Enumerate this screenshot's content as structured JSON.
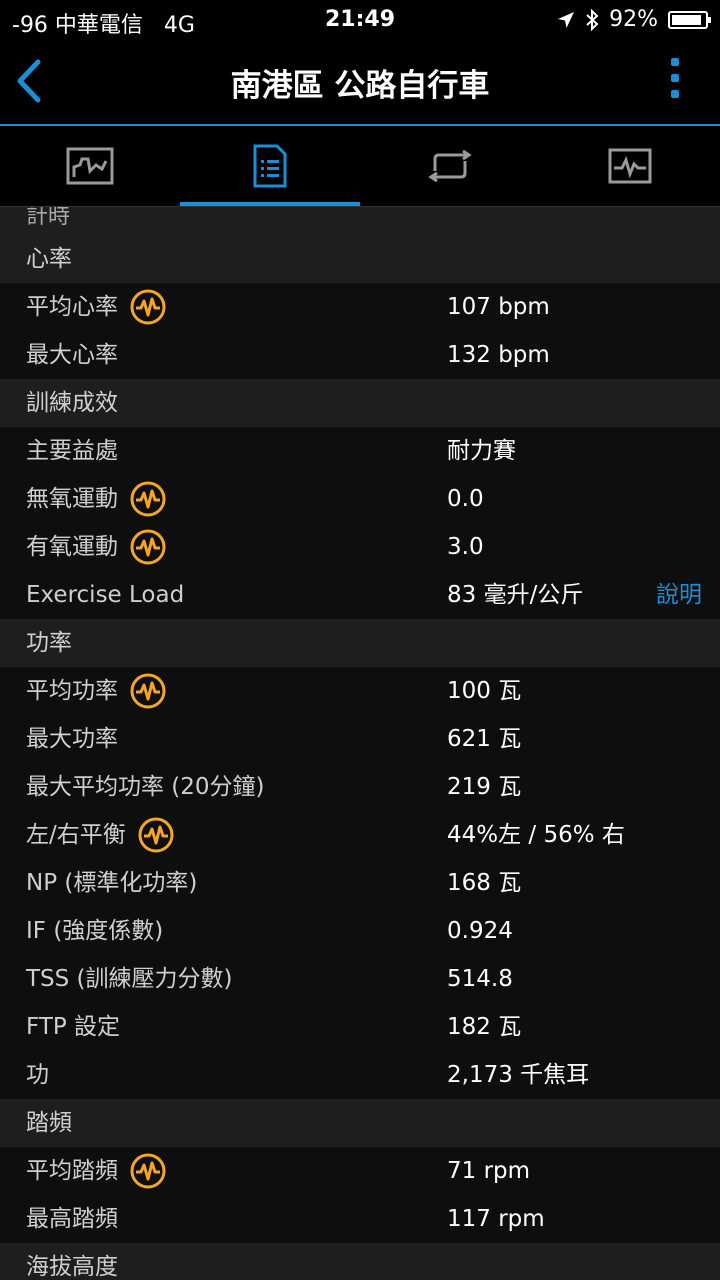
{
  "status": {
    "carrier": "-96 中華電信",
    "network": "4G",
    "time": "21:49",
    "battery": "92%",
    "battery_level": 0.92
  },
  "nav": {
    "title": "南港區 公路自行車"
  },
  "content": {
    "top_partial": "計時",
    "heart_rate": {
      "header": "心率",
      "rows": [
        {
          "label": "平均心率",
          "value": "107 bpm"
        },
        {
          "label": "最大心率",
          "value": "132 bpm"
        }
      ]
    },
    "training": {
      "header": "訓練成效",
      "rows": [
        {
          "label": "主要益處",
          "value": "耐力賽"
        },
        {
          "label": "無氧運動",
          "value": "0.0"
        },
        {
          "label": "有氧運動",
          "value": "3.0"
        },
        {
          "label": "Exercise Load",
          "value": "83 毫升/公斤",
          "link": "說明"
        }
      ]
    },
    "power": {
      "header": "功率",
      "rows": [
        {
          "label": "平均功率",
          "value": "100 瓦"
        },
        {
          "label": "最大功率",
          "value": "621 瓦"
        },
        {
          "label": "最大平均功率 (20分鐘)",
          "value": "219 瓦"
        },
        {
          "label": "左/右平衡",
          "value": "44%左 / 56% 右"
        },
        {
          "label": "NP (標準化功率)",
          "value": "168 瓦"
        },
        {
          "label": "IF (強度係數)",
          "value": "0.924"
        },
        {
          "label": "TSS (訓練壓力分數)",
          "value": "514.8"
        },
        {
          "label": "FTP 設定",
          "value": "182 瓦"
        },
        {
          "label": "功",
          "value": "2,173 千焦耳"
        }
      ]
    },
    "cadence": {
      "header": "踏頻",
      "rows": [
        {
          "label": "平均踏頻",
          "value": "71 rpm"
        },
        {
          "label": "最高踏頻",
          "value": "117 rpm"
        }
      ]
    },
    "bottom_partial": "海拔高度"
  },
  "colors": {
    "accent": "#1a8fd6",
    "icon_orange": "#f5a623",
    "section_bg": "#1e1e1e",
    "row_bg": "#0e0e0e"
  },
  "icons": [
    "back-chevron-icon",
    "more-vertical-icon",
    "chart-tab-icon",
    "details-tab-icon",
    "laps-tab-icon",
    "graph-tab-icon",
    "heart-rate-icon"
  ]
}
